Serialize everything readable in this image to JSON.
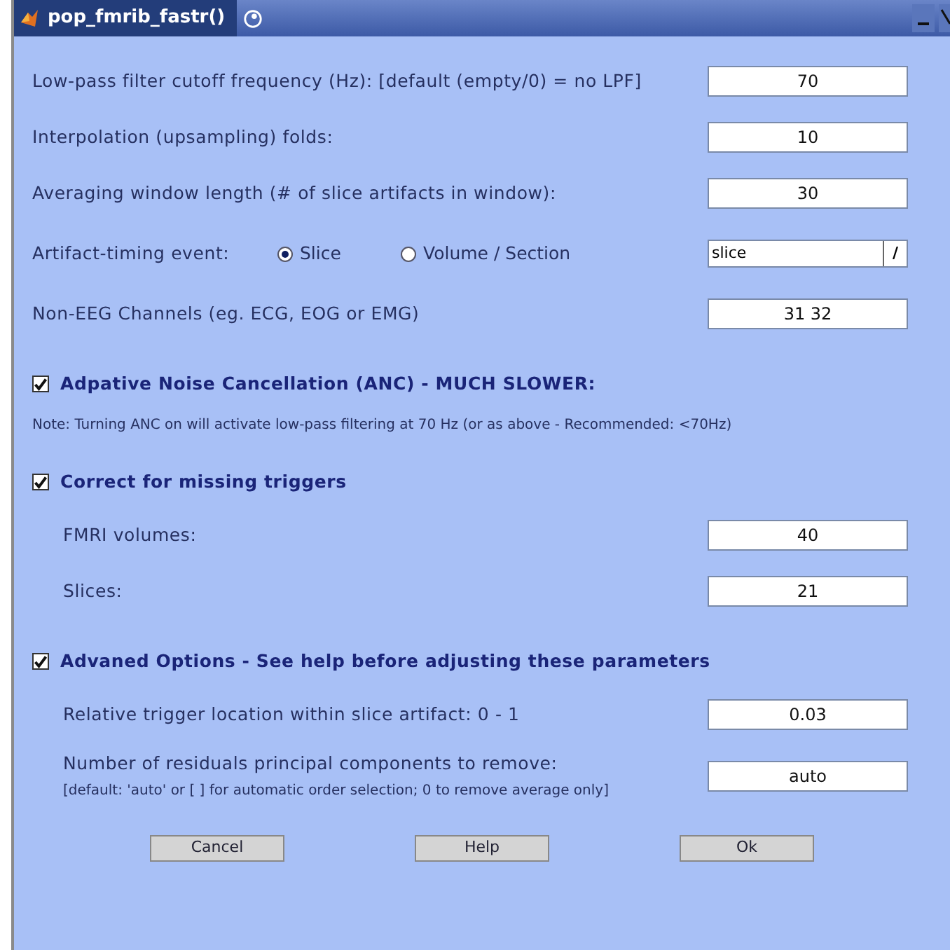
{
  "window": {
    "title": "pop_fmrib_fastr()"
  },
  "rows": [
    {
      "kind": "field",
      "label": "Low-pass filter cutoff frequency (Hz): [default (empty/0) = no LPF]",
      "value": "70"
    },
    {
      "kind": "field",
      "label": "Interpolation (upsampling) folds:",
      "value": "10"
    },
    {
      "kind": "field",
      "label": "Averaging window length (# of slice artifacts in window):",
      "value": "30"
    },
    {
      "kind": "radio",
      "label": "Artifact-timing event:",
      "options": [
        {
          "label": "Slice",
          "selected": true
        },
        {
          "label": "Volume / Section",
          "selected": false
        }
      ],
      "dropdown": {
        "value": "slice",
        "button": "/"
      }
    },
    {
      "kind": "field",
      "label": "Non-EEG Channels (eg. ECG, EOG or EMG)",
      "value": "31 32"
    },
    {
      "kind": "check",
      "label": "Adpative Noise Cancellation (ANC) - MUCH SLOWER:",
      "checked": true
    },
    {
      "kind": "note",
      "text": "Note: Turning ANC on will activate low-pass filtering at 70 Hz (or as above - Recommended: <70Hz)"
    },
    {
      "kind": "check",
      "label": "Correct for missing triggers",
      "checked": true
    },
    {
      "kind": "subfield",
      "label": "FMRI volumes:",
      "value": "40"
    },
    {
      "kind": "subfield",
      "label": "Slices:",
      "value": "21"
    },
    {
      "kind": "check",
      "label": "Advaned Options - See help before adjusting these parameters",
      "checked": true
    },
    {
      "kind": "subfield",
      "label": "Relative trigger location within slice artifact: 0 - 1",
      "value": "0.03"
    },
    {
      "kind": "subfield",
      "label": "Number of residuals principal components to remove:",
      "hint": "[default: 'auto' or [ ] for automatic order selection; 0 to remove average only]",
      "value": "auto"
    }
  ],
  "buttons": [
    "Cancel",
    "Help",
    "Ok"
  ]
}
